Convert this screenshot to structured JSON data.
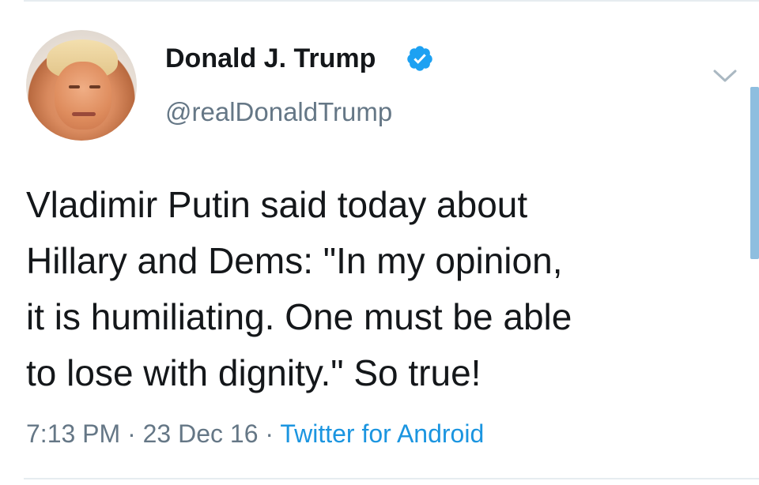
{
  "user": {
    "display_name": "Donald J. Trump",
    "handle": "@realDonaldTrump",
    "verified": true,
    "verified_icon": "verified-badge-icon",
    "avatar_icon": "profile-avatar"
  },
  "tweet": {
    "text": "Vladimir Putin said today about\nHillary and Dems: \"In my opinion,\nit is humiliating. One must be able\nto lose with dignity.\"  So true!",
    "time": "7:13 PM",
    "separator": "·",
    "date": "23 Dec 16",
    "source": "Twitter for Android"
  },
  "menu": {
    "icon": "chevron-down-icon"
  },
  "colors": {
    "text": "#14171a",
    "secondary": "#657786",
    "accent": "#1b95e0",
    "verified": "#1da1f2"
  }
}
